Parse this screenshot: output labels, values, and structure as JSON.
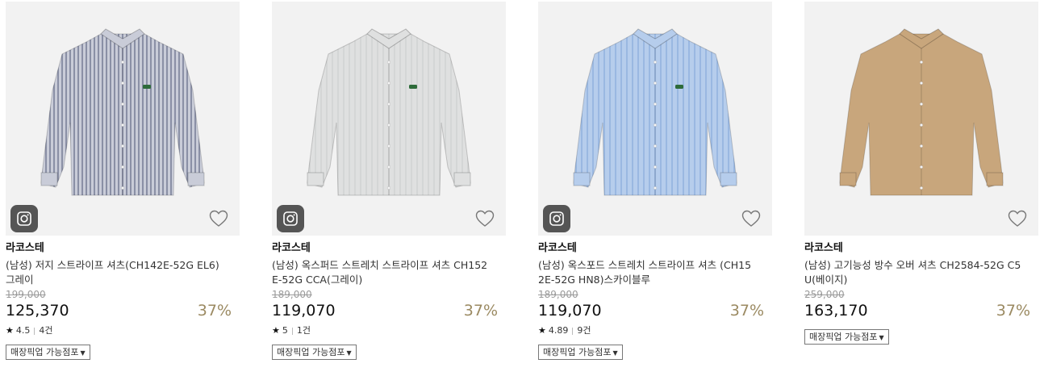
{
  "products": [
    {
      "brand": "라코스테",
      "name": "(남성) 저지 스트라이프 셔츠(CH142E-52G EL6)그레이",
      "original_price": "199,000",
      "price": "125,370",
      "discount": "37%",
      "rating": "4.5",
      "reviews": "4건",
      "pickup_label": "매장픽업 가능점포",
      "shirt_color": "#c9ccd8",
      "stripe_color": "#6f7690",
      "has_instagram": true
    },
    {
      "brand": "라코스테",
      "name": "(남성) 옥스퍼드 스트레치 스트라이프 셔츠 CH152E-52G CCA(그레이)",
      "original_price": "189,000",
      "price": "119,070",
      "discount": "37%",
      "rating": "5",
      "reviews": "1건",
      "pickup_label": "매장픽업 가능점포",
      "shirt_color": "#dfe0e0",
      "stripe_color": "#c4c6c6",
      "has_instagram": true
    },
    {
      "brand": "라코스테",
      "name": "(남성) 옥스포드 스트레치 스트라이프 셔츠 (CH152E-52G HN8)스카이블루",
      "original_price": "189,000",
      "price": "119,070",
      "discount": "37%",
      "rating": "4.89",
      "reviews": "9건",
      "pickup_label": "매장픽업 가능점포",
      "shirt_color": "#b6cdec",
      "stripe_color": "#8fb0dd",
      "has_instagram": true
    },
    {
      "brand": "라코스테",
      "name": "(남성) 고기능성 방수 오버 셔츠 CH2584-52G C5U(베이지)",
      "original_price": "259,000",
      "price": "163,170",
      "discount": "37%",
      "pickup_label": "매장픽업 가능점포",
      "shirt_color": "#c8a67c",
      "stripe_color": "#b8956a",
      "has_instagram": false
    }
  ],
  "icons": {
    "instagram": "camera-icon",
    "wishlist": "heart-icon",
    "rating": "star-icon",
    "dropdown": "caret-down-icon"
  },
  "colors": {
    "discount": "#9b8a62",
    "thumb_bg": "#f2f2f2",
    "insta_bg": "#555555"
  }
}
